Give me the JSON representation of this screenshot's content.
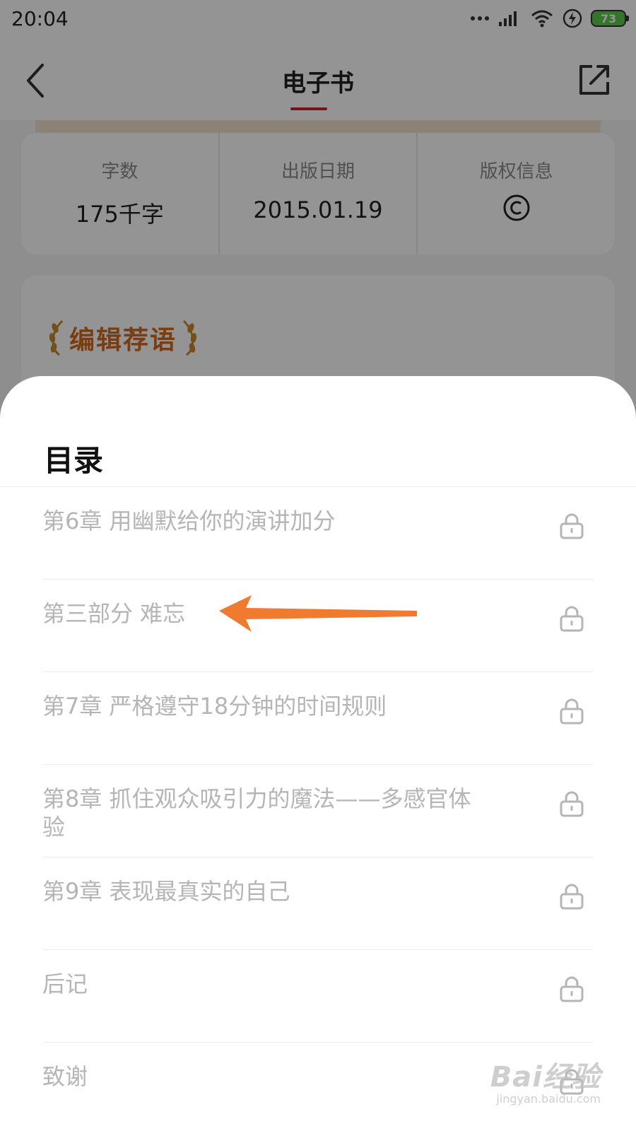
{
  "status_bar": {
    "time": "20:04",
    "battery": "73"
  },
  "nav": {
    "title": "电子书"
  },
  "info": {
    "items": [
      {
        "label": "字数",
        "value": "175千字"
      },
      {
        "label": "出版日期",
        "value": "2015.01.19"
      },
      {
        "label": "版权信息"
      }
    ]
  },
  "editor": {
    "title": "编辑荐语"
  },
  "toc": {
    "title": "目录",
    "items": [
      {
        "label": "第6章 用幽默给你的演讲加分",
        "locked": true
      },
      {
        "label": "第三部分 难忘",
        "locked": true
      },
      {
        "label": "第7章 严格遵守18分钟的时间规则",
        "locked": true
      },
      {
        "label": "第8章 抓住观众吸引力的魔法——多感官体验",
        "locked": true
      },
      {
        "label": "第9章 表现最真实的自己",
        "locked": true
      },
      {
        "label": "后记",
        "locked": true
      },
      {
        "label": "致谢",
        "locked": true
      }
    ]
  },
  "watermark": {
    "brand": "Bai经验",
    "url": "jingyan.baidu.com"
  },
  "colors": {
    "accent": "#c9232b",
    "annotation_arrow": "#f07a2e",
    "editor_title": "#d2691e"
  }
}
